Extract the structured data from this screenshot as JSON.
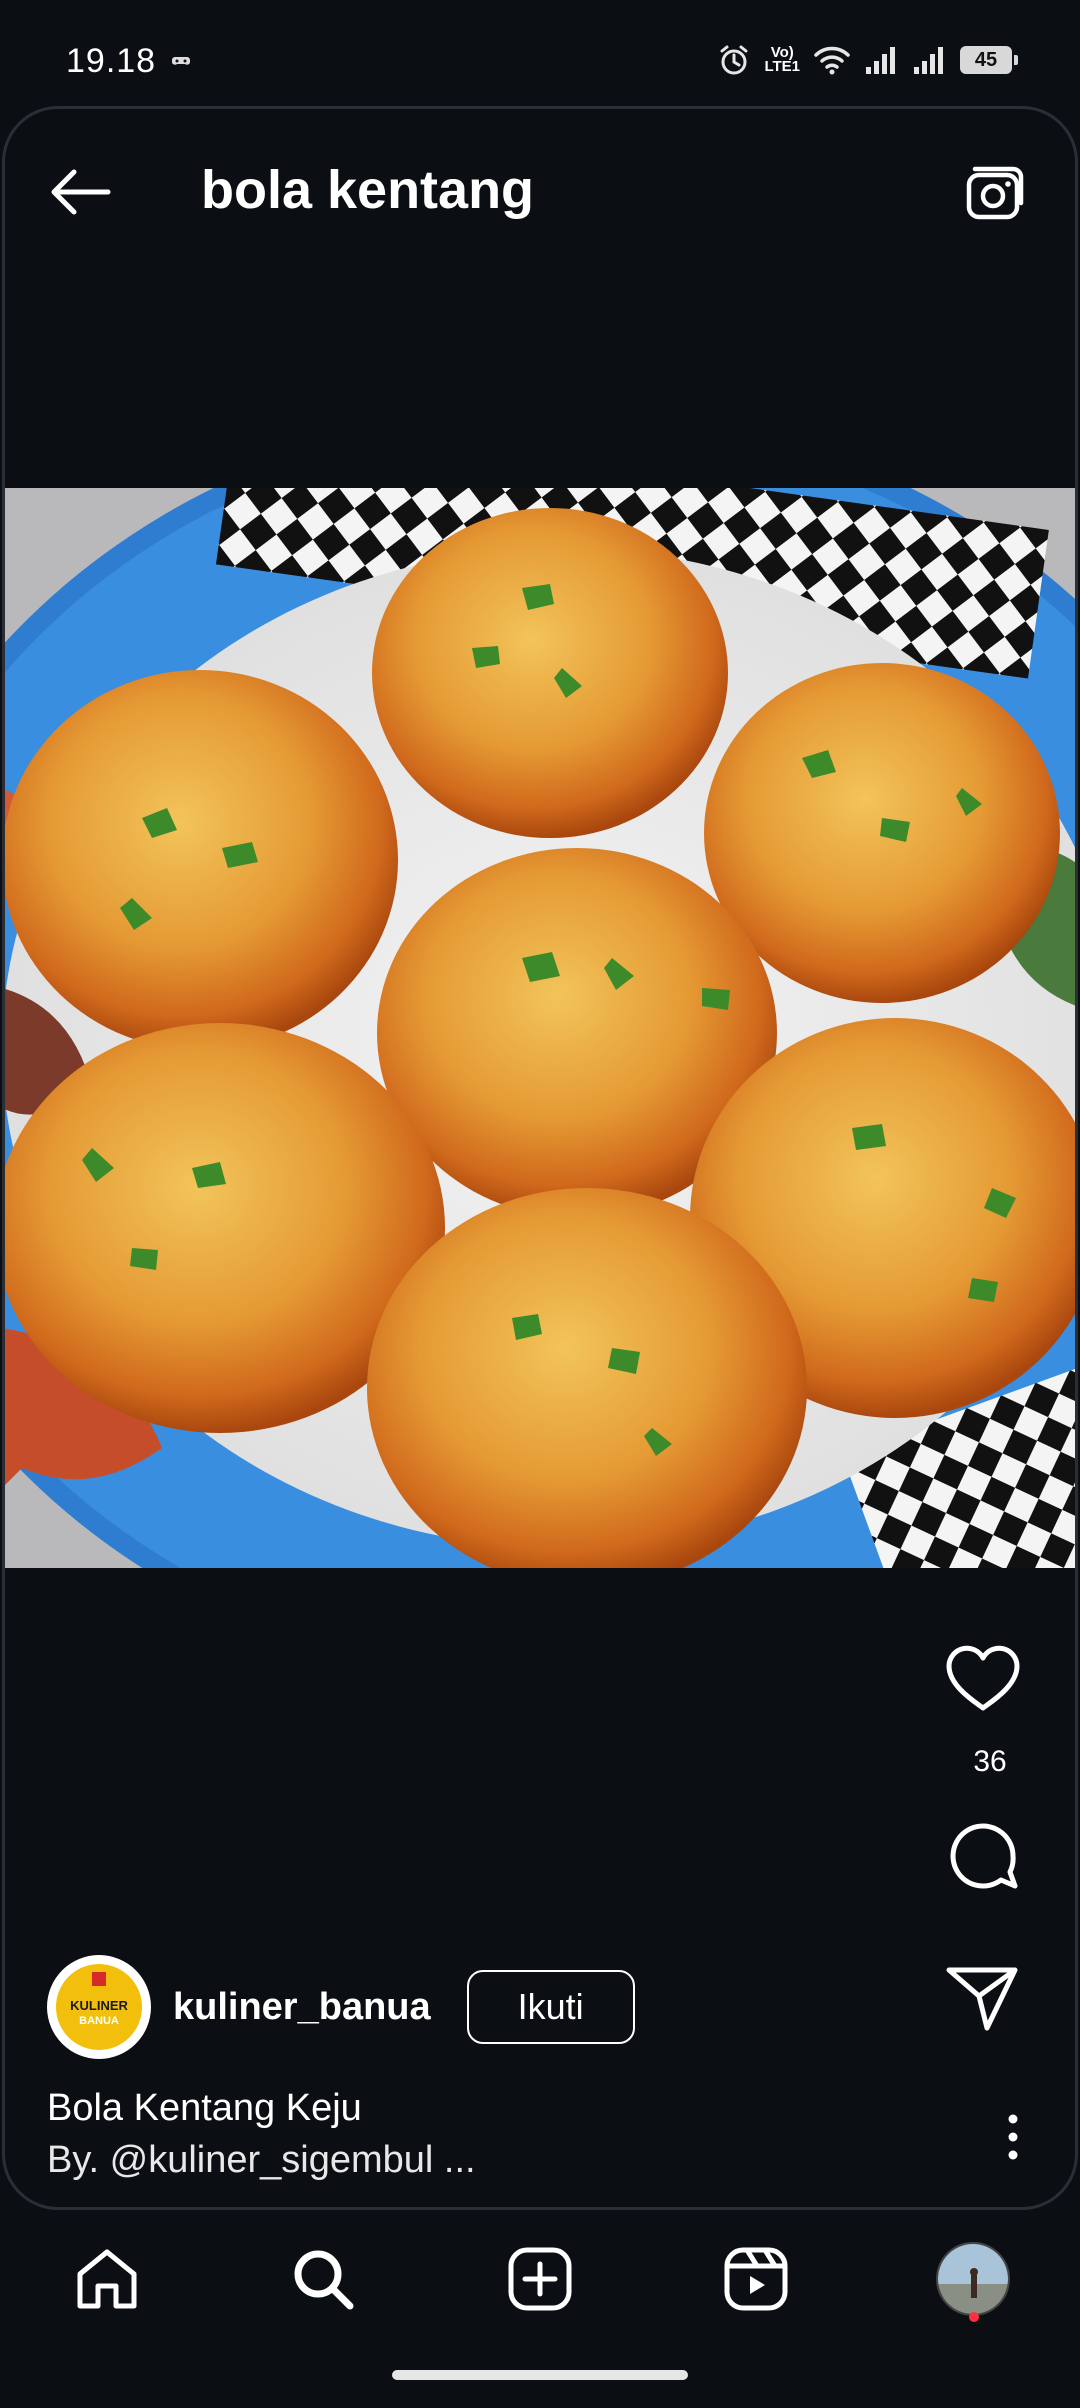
{
  "status_bar": {
    "time": "19.18",
    "battery": "45",
    "network": "Vo) LTE1",
    "icons": [
      "game-controller-icon",
      "alarm-icon",
      "lte-icon",
      "wifi-icon",
      "signal-icon",
      "signal-icon",
      "battery-icon"
    ]
  },
  "header": {
    "title": "bola kentang",
    "back_icon": "arrow-left-icon",
    "camera_icon": "camera-icon"
  },
  "post": {
    "image_icon": "food-photo",
    "likes": "36",
    "author": {
      "username": "kuliner_banua",
      "follow_label": "Ikuti",
      "avatar_text_line1": "KULINER",
      "avatar_text_line2": "BANUA"
    },
    "caption_title": "Bola Kentang Keju",
    "caption_sub": "By. @kuliner_sigembul ...",
    "actions": [
      "heart-icon",
      "comment-icon",
      "send-icon",
      "more-icon"
    ]
  },
  "bottom_nav": {
    "items": [
      "home-icon",
      "search-icon",
      "add-icon",
      "reels-icon",
      "profile-avatar"
    ]
  },
  "colors": {
    "background": "#0b0e13",
    "text": "#ffffff",
    "notification_dot": "#ff3040"
  }
}
